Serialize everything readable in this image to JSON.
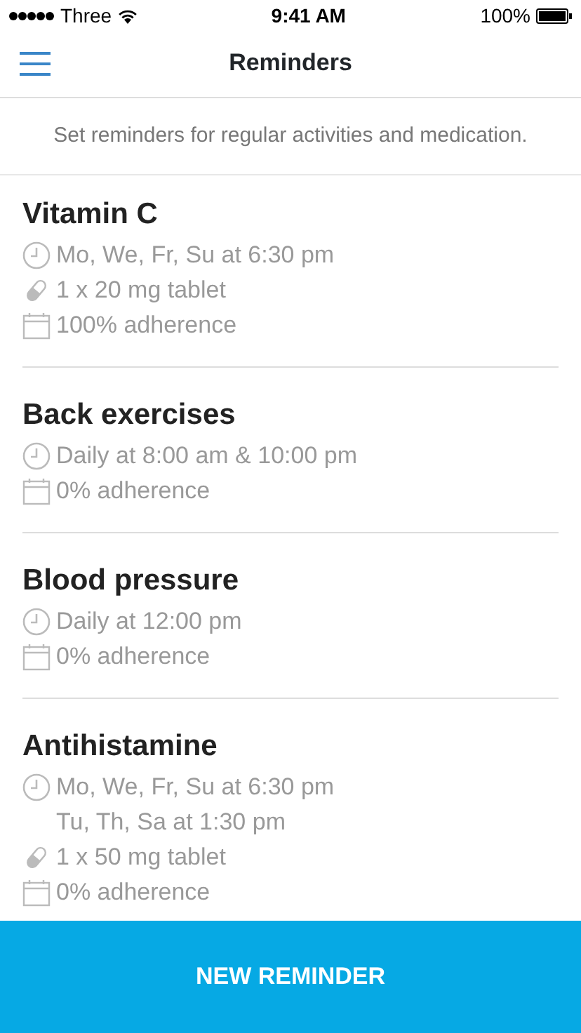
{
  "status_bar": {
    "carrier": "Three",
    "time": "9:41 AM",
    "battery": "100%"
  },
  "header": {
    "title": "Reminders"
  },
  "intro": "Set reminders for regular activities and medication.",
  "reminders": [
    {
      "name": "Vitamin C",
      "details": [
        {
          "kind": "schedule",
          "lines": [
            "Mo, We, Fr, Su at 6:30 pm"
          ]
        },
        {
          "kind": "dose",
          "lines": [
            "1 x 20 mg tablet"
          ]
        },
        {
          "kind": "adherence",
          "lines": [
            "100% adherence"
          ]
        }
      ]
    },
    {
      "name": "Back exercises",
      "details": [
        {
          "kind": "schedule",
          "lines": [
            "Daily at 8:00 am & 10:00 pm"
          ]
        },
        {
          "kind": "adherence",
          "lines": [
            "0% adherence"
          ]
        }
      ]
    },
    {
      "name": "Blood pressure",
      "details": [
        {
          "kind": "schedule",
          "lines": [
            "Daily at 12:00 pm"
          ]
        },
        {
          "kind": "adherence",
          "lines": [
            "0% adherence"
          ]
        }
      ]
    },
    {
      "name": "Antihistamine",
      "details": [
        {
          "kind": "schedule",
          "lines": [
            "Mo, We, Fr, Su at 6:30 pm",
            "Tu, Th, Sa at 1:30 pm"
          ]
        },
        {
          "kind": "dose",
          "lines": [
            "1 x 50 mg tablet"
          ]
        },
        {
          "kind": "adherence",
          "lines": [
            "0% adherence"
          ]
        }
      ]
    }
  ],
  "action_button": "NEW REMINDER"
}
